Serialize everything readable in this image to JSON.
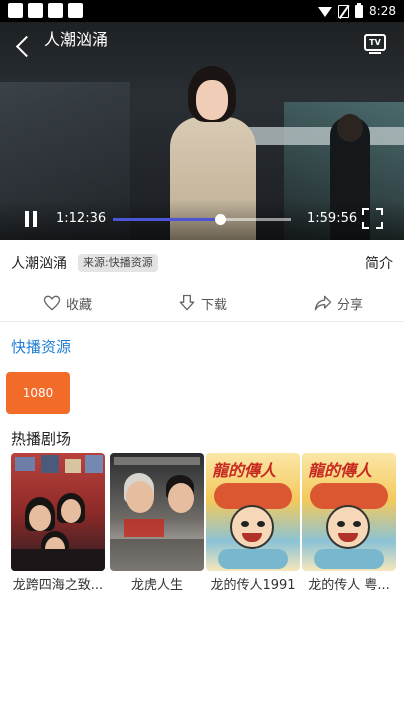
{
  "status_bar": {
    "time": "8:28"
  },
  "player": {
    "title": "人潮汹涌",
    "current_time": "1:12:36",
    "total_time": "1:59:56",
    "progress": 0.6,
    "progress_color": "#4b55d6"
  },
  "info": {
    "title": "人潮汹涌",
    "source_badge": "来源:快播资源",
    "intro_label": "简介"
  },
  "actions": {
    "favorite": "收藏",
    "download": "下载",
    "share": "分享"
  },
  "source_section": {
    "title": "快播资源",
    "title_color": "#1f7fd6",
    "episodes": [
      "1080"
    ],
    "episode_color": "#f26b28"
  },
  "hot_section": {
    "title": "热播剧场",
    "items": [
      {
        "title": "龙跨四海之致..."
      },
      {
        "title": "龙虎人生"
      },
      {
        "title": "龙的传人1991"
      },
      {
        "title": "龙的传人 粤..."
      }
    ]
  }
}
